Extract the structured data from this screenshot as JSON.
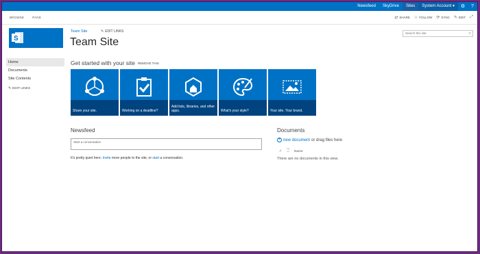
{
  "suite_bar": {
    "links": [
      "Newsfeed",
      "SkyDrive",
      "Sites"
    ],
    "active_link": "Sites",
    "account": "System Account ▾",
    "settings_icon": "gear-icon",
    "help_icon": "help-icon"
  },
  "ribbon": {
    "tabs": [
      "BROWSE",
      "PAGE"
    ],
    "actions": {
      "share": "SHARE",
      "follow": "FOLLOW",
      "sync": "SYNC",
      "edit": "EDIT"
    }
  },
  "header": {
    "site_link": "Team Site",
    "edit_links": "EDIT LINKS",
    "title": "Team Site",
    "search_placeholder": "Search this site"
  },
  "left_nav": {
    "items": [
      "Home",
      "Documents",
      "Site Contents"
    ],
    "selected": "Home",
    "edit_links": "EDIT LINKS"
  },
  "getting_started": {
    "title": "Get started with your site",
    "remove": "REMOVE THIS",
    "tiles": [
      {
        "label": "Share your site.",
        "icon": "share-icon"
      },
      {
        "label": "Working on a deadline?",
        "icon": "clipboard-check-icon"
      },
      {
        "label": "Add lists, libraries, and other apps.",
        "icon": "apps-hexagon-icon"
      },
      {
        "label": "What's your style?",
        "icon": "palette-icon"
      },
      {
        "label": "Your site. Your brand.",
        "icon": "brand-image-icon"
      }
    ]
  },
  "newsfeed": {
    "title": "Newsfeed",
    "placeholder": "Start a conversation",
    "quiet_prefix": "It's pretty quiet here. ",
    "invite": "Invite",
    "quiet_mid": " more people to the site, or ",
    "start": "start",
    "quiet_suffix": " a conversation."
  },
  "documents": {
    "title": "Documents",
    "new_document": "new document",
    "drag_text": " or drag files here",
    "column_name": "Name",
    "empty": "There are no documents in this view."
  },
  "colors": {
    "brand_blue": "#0072c6",
    "frame_purple": "#6d2b7f"
  }
}
